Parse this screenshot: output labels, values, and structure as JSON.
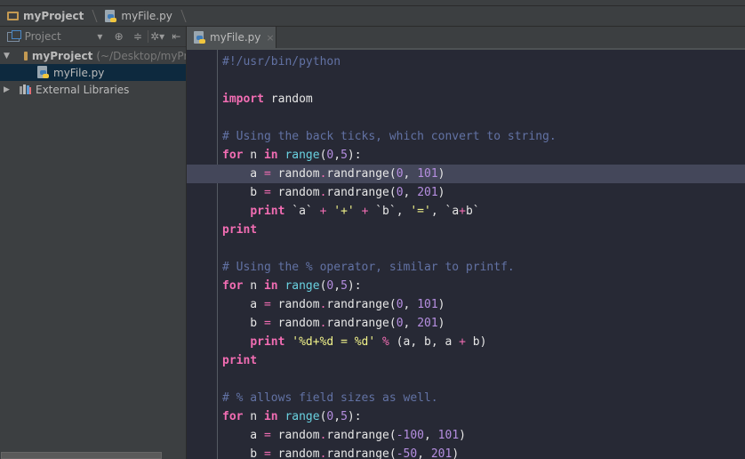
{
  "navbar": {
    "breadcrumbs": [
      {
        "label": "myProject",
        "icon": "folder-icon"
      },
      {
        "label": "myFile.py",
        "icon": "python-file-icon"
      }
    ]
  },
  "sidebar": {
    "toolbar": {
      "view_label": "Project",
      "buttons": [
        "dropdown-arrow",
        "locate-icon",
        "collapse-all-icon",
        "gear-icon",
        "hide-icon"
      ]
    },
    "tree": [
      {
        "label": "myProject",
        "suffix": "(~/Desktop/myProject)",
        "icon": "folder-icon",
        "expanded": true,
        "level": 0
      },
      {
        "label": "myFile.py",
        "icon": "python-file-icon",
        "selected": true,
        "level": 1
      },
      {
        "label": "External Libraries",
        "icon": "library-icon",
        "expanded": false,
        "level": 0
      }
    ]
  },
  "tabs": [
    {
      "label": "myFile.py",
      "active": true,
      "close": "×"
    }
  ],
  "editor": {
    "highlighted_line": 7,
    "lines": [
      [
        {
          "t": "cm",
          "v": "#!/usr/bin/python"
        }
      ],
      [],
      [
        {
          "t": "kw",
          "v": "import"
        },
        {
          "t": "id",
          "v": " random"
        }
      ],
      [],
      [
        {
          "t": "cm",
          "v": "# Using the back ticks, which convert to string."
        }
      ],
      [
        {
          "t": "kw",
          "v": "for"
        },
        {
          "t": "id",
          "v": " n "
        },
        {
          "t": "kw",
          "v": "in"
        },
        {
          "t": "id",
          "v": " "
        },
        {
          "t": "fn",
          "v": "range"
        },
        {
          "t": "id",
          "v": "("
        },
        {
          "t": "num",
          "v": "0"
        },
        {
          "t": "id",
          "v": ","
        },
        {
          "t": "num",
          "v": "5"
        },
        {
          "t": "id",
          "v": "):"
        }
      ],
      [
        {
          "t": "id",
          "v": "    a "
        },
        {
          "t": "op",
          "v": "="
        },
        {
          "t": "id",
          "v": " random"
        },
        {
          "t": "op",
          "v": "."
        },
        {
          "t": "id",
          "v": "randrange("
        },
        {
          "t": "num",
          "v": "0"
        },
        {
          "t": "id",
          "v": ", "
        },
        {
          "t": "num",
          "v": "101"
        },
        {
          "t": "id",
          "v": ")"
        }
      ],
      [
        {
          "t": "id",
          "v": "    b "
        },
        {
          "t": "op",
          "v": "="
        },
        {
          "t": "id",
          "v": " random"
        },
        {
          "t": "op",
          "v": "."
        },
        {
          "t": "id",
          "v": "randrange("
        },
        {
          "t": "num",
          "v": "0"
        },
        {
          "t": "id",
          "v": ", "
        },
        {
          "t": "num",
          "v": "201"
        },
        {
          "t": "id",
          "v": ")"
        }
      ],
      [
        {
          "t": "id",
          "v": "    "
        },
        {
          "t": "kw",
          "v": "print"
        },
        {
          "t": "id",
          "v": " `a` "
        },
        {
          "t": "op",
          "v": "+"
        },
        {
          "t": "str",
          "v": " '+' "
        },
        {
          "t": "op",
          "v": "+"
        },
        {
          "t": "id",
          "v": " `b`, "
        },
        {
          "t": "str",
          "v": "'='"
        },
        {
          "t": "id",
          "v": ", `a"
        },
        {
          "t": "op",
          "v": "+"
        },
        {
          "t": "id",
          "v": "b`"
        }
      ],
      [
        {
          "t": "kw",
          "v": "print"
        }
      ],
      [],
      [
        {
          "t": "cm",
          "v": "# Using the % operator, similar to printf."
        }
      ],
      [
        {
          "t": "kw",
          "v": "for"
        },
        {
          "t": "id",
          "v": " n "
        },
        {
          "t": "kw",
          "v": "in"
        },
        {
          "t": "id",
          "v": " "
        },
        {
          "t": "fn",
          "v": "range"
        },
        {
          "t": "id",
          "v": "("
        },
        {
          "t": "num",
          "v": "0"
        },
        {
          "t": "id",
          "v": ","
        },
        {
          "t": "num",
          "v": "5"
        },
        {
          "t": "id",
          "v": "):"
        }
      ],
      [
        {
          "t": "id",
          "v": "    a "
        },
        {
          "t": "op",
          "v": "="
        },
        {
          "t": "id",
          "v": " random"
        },
        {
          "t": "op",
          "v": "."
        },
        {
          "t": "id",
          "v": "randrange("
        },
        {
          "t": "num",
          "v": "0"
        },
        {
          "t": "id",
          "v": ", "
        },
        {
          "t": "num",
          "v": "101"
        },
        {
          "t": "id",
          "v": ")"
        }
      ],
      [
        {
          "t": "id",
          "v": "    b "
        },
        {
          "t": "op",
          "v": "="
        },
        {
          "t": "id",
          "v": " random"
        },
        {
          "t": "op",
          "v": "."
        },
        {
          "t": "id",
          "v": "randrange("
        },
        {
          "t": "num",
          "v": "0"
        },
        {
          "t": "id",
          "v": ", "
        },
        {
          "t": "num",
          "v": "201"
        },
        {
          "t": "id",
          "v": ")"
        }
      ],
      [
        {
          "t": "id",
          "v": "    "
        },
        {
          "t": "kw",
          "v": "print"
        },
        {
          "t": "id",
          "v": " "
        },
        {
          "t": "str",
          "v": "'%d+%d = %d'"
        },
        {
          "t": "id",
          "v": " "
        },
        {
          "t": "op",
          "v": "%"
        },
        {
          "t": "id",
          "v": " (a, b, a "
        },
        {
          "t": "op",
          "v": "+"
        },
        {
          "t": "id",
          "v": " b)"
        }
      ],
      [
        {
          "t": "kw",
          "v": "print"
        }
      ],
      [],
      [
        {
          "t": "cm",
          "v": "# % allows field sizes as well."
        }
      ],
      [
        {
          "t": "kw",
          "v": "for"
        },
        {
          "t": "id",
          "v": " n "
        },
        {
          "t": "kw",
          "v": "in"
        },
        {
          "t": "id",
          "v": " "
        },
        {
          "t": "fn",
          "v": "range"
        },
        {
          "t": "id",
          "v": "("
        },
        {
          "t": "num",
          "v": "0"
        },
        {
          "t": "id",
          "v": ","
        },
        {
          "t": "num",
          "v": "5"
        },
        {
          "t": "id",
          "v": "):"
        }
      ],
      [
        {
          "t": "id",
          "v": "    a "
        },
        {
          "t": "op",
          "v": "="
        },
        {
          "t": "id",
          "v": " random"
        },
        {
          "t": "op",
          "v": "."
        },
        {
          "t": "id",
          "v": "randrange("
        },
        {
          "t": "num",
          "v": "-100"
        },
        {
          "t": "id",
          "v": ", "
        },
        {
          "t": "num",
          "v": "101"
        },
        {
          "t": "id",
          "v": ")"
        }
      ],
      [
        {
          "t": "id",
          "v": "    b "
        },
        {
          "t": "op",
          "v": "="
        },
        {
          "t": "id",
          "v": " random"
        },
        {
          "t": "op",
          "v": "."
        },
        {
          "t": "id",
          "v": "randrange("
        },
        {
          "t": "num",
          "v": "-50"
        },
        {
          "t": "id",
          "v": ", "
        },
        {
          "t": "num",
          "v": "201"
        },
        {
          "t": "id",
          "v": ")"
        }
      ]
    ]
  }
}
